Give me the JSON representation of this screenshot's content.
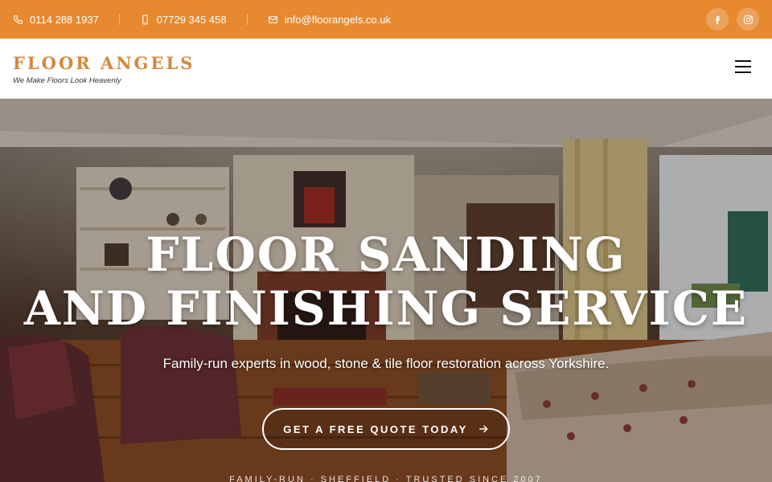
{
  "topbar": {
    "phone_landline": "0114 288 1937",
    "phone_mobile": "07729 345 458",
    "email": "info@floorangels.co.uk",
    "socials": [
      "facebook-icon",
      "instagram-icon"
    ],
    "accent_color": "#e6892f"
  },
  "header": {
    "brand": "FLOOR ANGELS",
    "tagline": "We Make Floors Look Heavenly",
    "menu_icon": "hamburger-menu-icon",
    "brand_color": "#d4893a"
  },
  "hero": {
    "title_line1": "FLOOR SANDING",
    "title_line2": "AND FINISHING SERVICE",
    "subtitle": "Family-run experts in wood, stone & tile floor restoration across Yorkshire.",
    "cta_label": "GET A FREE QUOTE TODAY",
    "cta_icon": "arrow-right-icon",
    "trust_line": "FAMILY-RUN · SHEFFIELD · TRUSTED SINCE 2007"
  }
}
